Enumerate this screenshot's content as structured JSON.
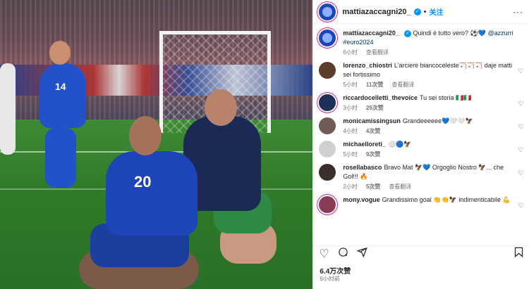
{
  "post": {
    "username": "mattiazaccagni20_",
    "follow_label": "关注",
    "more_label": "···",
    "caption": {
      "text": "Quindi è tutto vero? ⚽💙 ",
      "mentions": "@azzurri",
      "hashtag": "#euro2024",
      "time": "6小时",
      "translate": "查看翻译"
    },
    "likes": "6.4万次赞",
    "posted": "6小时前",
    "photo": {
      "number_main": "20",
      "number_back": "14"
    }
  },
  "comments": [
    {
      "user": "lorenzo_chiostri",
      "text": "L'arciere biancoceleste🏹🏹🏹 daje matti sei fortissimo",
      "time": "5小时",
      "likes": "11次赞",
      "translate": "查看翻译",
      "avatar_color": "#5a3d2b"
    },
    {
      "user": "riccardocelletti_thevoice",
      "text": "Tu sei storia 🇮🇹🇮🇹",
      "time": "3小时",
      "likes": "29次赞",
      "translate": "",
      "avatar_color": "#1f2f55"
    },
    {
      "user": "monicamissingsun",
      "text": "Grandeeeeee💙🤍🤍🦅",
      "time": "4小时",
      "likes": "4次赞",
      "translate": "",
      "avatar_color": "#6f5d55"
    },
    {
      "user": "michaelloreti_",
      "text": "⚪🔵🦅",
      "time": "5小时",
      "likes": "9次赞",
      "translate": "",
      "avatar_color": "#d0d0d0"
    },
    {
      "user": "rosellabasco",
      "text": "Bravo Mat 🦅💙 Orgoglio Nostro 🦅... che Gol!!! 🔥",
      "time": "2小时",
      "likes": "5次赞",
      "translate": "查看翻译",
      "avatar_color": "#3a2f2c"
    },
    {
      "user": "mony.vogue",
      "text": "Grandissimo goal 👏👏🦅 indimenticabile 💪",
      "time": "",
      "likes": "",
      "translate": "",
      "avatar_color": "#8a3b55"
    }
  ],
  "icons": {
    "heart": "heart-icon",
    "comment": "comment-icon",
    "share": "share-icon",
    "save": "bookmark-icon"
  },
  "colors": {
    "accent": "#0095f6",
    "link": "#00376b",
    "meta": "#737373"
  }
}
